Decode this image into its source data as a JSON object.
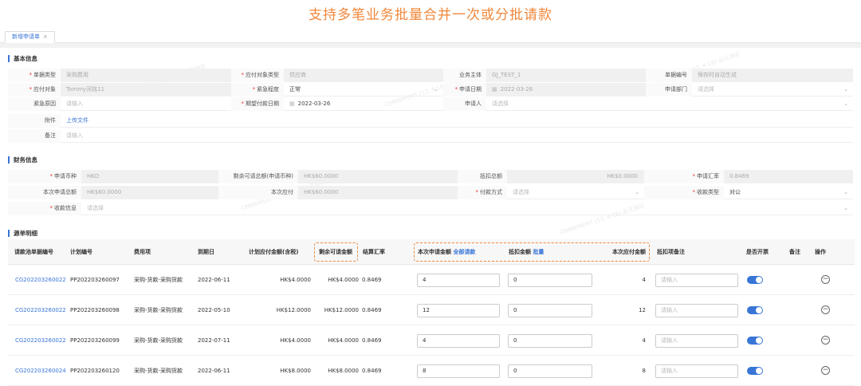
{
  "banner": "支持多笔业务批量合并一次或分批请款",
  "tab": {
    "label": "新增申请单",
    "close": "×"
  },
  "basic": {
    "title": "基本信息",
    "doc_type_label": "单据类型",
    "doc_type_value": "采购费用",
    "payee_type_label": "应付对象类型",
    "payee_type_value": "供应商",
    "entity_label": "业务主体",
    "entity_value": "GJ_TEST_1",
    "doc_no_label": "单据编号",
    "doc_no_value": "保存时自动生成",
    "payee_label": "应付对象",
    "payee_value": "Tommy河铭11",
    "urgency_label": "紧急程度",
    "urgency_value": "正常",
    "apply_date_label": "申请日期",
    "apply_date_value": "2022-03-26",
    "dept_label": "申请部门",
    "dept_placeholder": "请选择",
    "urgent_reason_label": "紧急原因",
    "urgent_reason_placeholder": "请输入",
    "expected_pay_label": "期望付款日期",
    "expected_pay_value": "2022-03-26",
    "applicant_label": "申请人",
    "applicant_placeholder": "请选择",
    "attachment_label": "附件",
    "attachment_link": "上传文件",
    "remark_label": "备注",
    "remark_placeholder": "请输入"
  },
  "finance": {
    "title": "财务信息",
    "currency_label": "申请币种",
    "currency_value": "HKD",
    "remaining_label": "剩余可请总额(申请币种)",
    "remaining_value": "HK$60.0000",
    "deduct_total_label": "抵扣总额",
    "deduct_total_value": "HK$0.0000",
    "rate_label": "申请汇率",
    "rate_value": "0.8469",
    "apply_total_label": "本次申请总额",
    "apply_total_value": "HK$60.0000",
    "payable_label": "本次应付",
    "payable_value": "HK$60.0000",
    "pay_method_label": "付款方式",
    "pay_method_placeholder": "请选择",
    "recv_type_label": "收款类型",
    "recv_type_value": "对公",
    "recv_info_label": "收款信息",
    "recv_info_placeholder": "请选择"
  },
  "detail": {
    "title": "源单明细",
    "headers": {
      "src_no": "请款池单据编号",
      "plan_no": "计划编号",
      "fee": "费用项",
      "due": "到期日",
      "payable_tax": "计划应付金额(含税)",
      "remaining": "剩余可请金额",
      "rate": "结算汇率",
      "apply_amt": "本次申请金额",
      "apply_all": "全部请款",
      "deduct_amt": "抵扣金额",
      "deduct_batch": "批量",
      "this_pay": "本次应付金额",
      "deduct_remark": "抵扣项备注",
      "invoice": "是否开票",
      "remark_short": "备注",
      "op": "操作"
    },
    "rows": [
      {
        "src_no": "CG202203260022",
        "plan_no": "PP202203260097",
        "fee": "采购-货款-采购货款",
        "due": "2022-06-11",
        "payable": "HK$4.0000",
        "remaining": "HK$4.0000",
        "rate": "0.8469",
        "apply": "4",
        "deduct": "0",
        "this_pay": "4",
        "remark_ph": "请输入",
        "invoice": true
      },
      {
        "src_no": "CG202203260022",
        "plan_no": "PP202203260098",
        "fee": "采购-货款-采购货款",
        "due": "2022-05-10",
        "payable": "HK$12.0000",
        "remaining": "HK$12.0000",
        "rate": "0.8469",
        "apply": "12",
        "deduct": "0",
        "this_pay": "12",
        "remark_ph": "请输入",
        "invoice": true
      },
      {
        "src_no": "CG202203260022",
        "plan_no": "PP202203260099",
        "fee": "采购-货款-采购货款",
        "due": "2022-07-11",
        "payable": "HK$4.0000",
        "remaining": "HK$4.0000",
        "rate": "0.8469",
        "apply": "4",
        "deduct": "0",
        "this_pay": "4",
        "remark_ph": "请输入",
        "invoice": true
      },
      {
        "src_no": "CG202203260024",
        "plan_no": "PP202203260120",
        "fee": "采购-货款-采购货款",
        "due": "2022-06-11",
        "payable": "HK$8.0000",
        "remaining": "HK$8.0000",
        "rate": "0.8469",
        "apply": "8",
        "deduct": "0",
        "this_pay": "8",
        "remark_ph": "请输入",
        "invoice": true
      }
    ]
  },
  "colors": {
    "accent": "#3875d7",
    "highlight": "#f08a3c",
    "required": "#e33"
  }
}
